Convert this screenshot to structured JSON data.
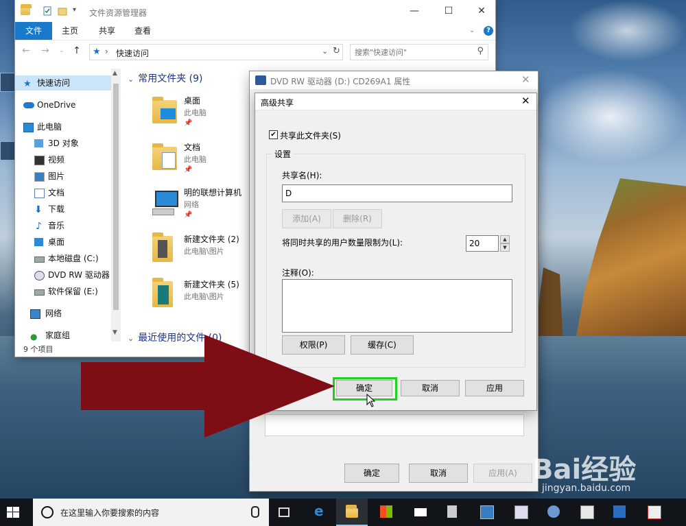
{
  "explorer": {
    "title": "文件资源管理器",
    "ribbon_tabs": [
      "文件",
      "主页",
      "共享",
      "查看"
    ],
    "address": "快速访问",
    "search_placeholder": "搜索\"快速访问\"",
    "nav": [
      "快速访问",
      "OneDrive",
      "此电脑",
      "3D 对象",
      "视频",
      "图片",
      "文档",
      "下载",
      "音乐",
      "桌面",
      "本地磁盘 (C:)",
      "DVD RW 驱动器",
      "软件保留 (E:)",
      "网络",
      "家庭组"
    ],
    "frequent_header": "常用文件夹 (9)",
    "recent_header": "最近使用的文件 (0)",
    "items": [
      {
        "name": "桌面",
        "sub": "此电脑",
        "icon": "desktop-folder-icon"
      },
      {
        "name": "文档",
        "sub": "此电脑",
        "icon": "documents-folder-icon"
      },
      {
        "name": "明的联想计算机",
        "sub": "网络",
        "icon": "computer-icon"
      },
      {
        "name": "新建文件夹 (2)",
        "sub": "此电脑\\图片",
        "icon": "folder-icon"
      },
      {
        "name": "新建文件夹 (5)",
        "sub": "此电脑\\图片",
        "icon": "folder-icon"
      }
    ],
    "status": "9 个项目"
  },
  "properties": {
    "title": "DVD RW 驱动器 (D:) CD269A1 属性",
    "ok": "确定",
    "cancel": "取消",
    "apply": "应用(A)"
  },
  "advanced": {
    "title": "高级共享",
    "share_checkbox": "共享此文件夹(S)",
    "share_checked": true,
    "settings_group": "设置",
    "share_name_label": "共享名(H):",
    "share_name_value": "D",
    "add": "添加(A)",
    "remove": "删除(R)",
    "limit_label": "将同时共享的用户数量限制为(L):",
    "limit_value": "20",
    "comment_label": "注释(O):",
    "comment_value": "",
    "permissions": "权限(P)",
    "caching": "缓存(C)",
    "ok": "确定",
    "cancel": "取消",
    "apply": "应用"
  },
  "taskbar": {
    "search_placeholder": "在这里输入你要搜索的内容",
    "apps": [
      "task-view-icon",
      "edge-icon",
      "file-explorer-icon",
      "store-icon",
      "mail-icon",
      "calculator-icon",
      "remote-desktop-icon",
      "screenshot-icon",
      "network-share-icon",
      "settings-app-icon",
      "sharing-icon"
    ]
  },
  "watermark": {
    "brand": "Bai经验",
    "url": "jingyan.baidu.com"
  },
  "colors": {
    "accent": "#1979ca",
    "highlight": "#1fd21f",
    "arrow": "#7e0d16"
  }
}
